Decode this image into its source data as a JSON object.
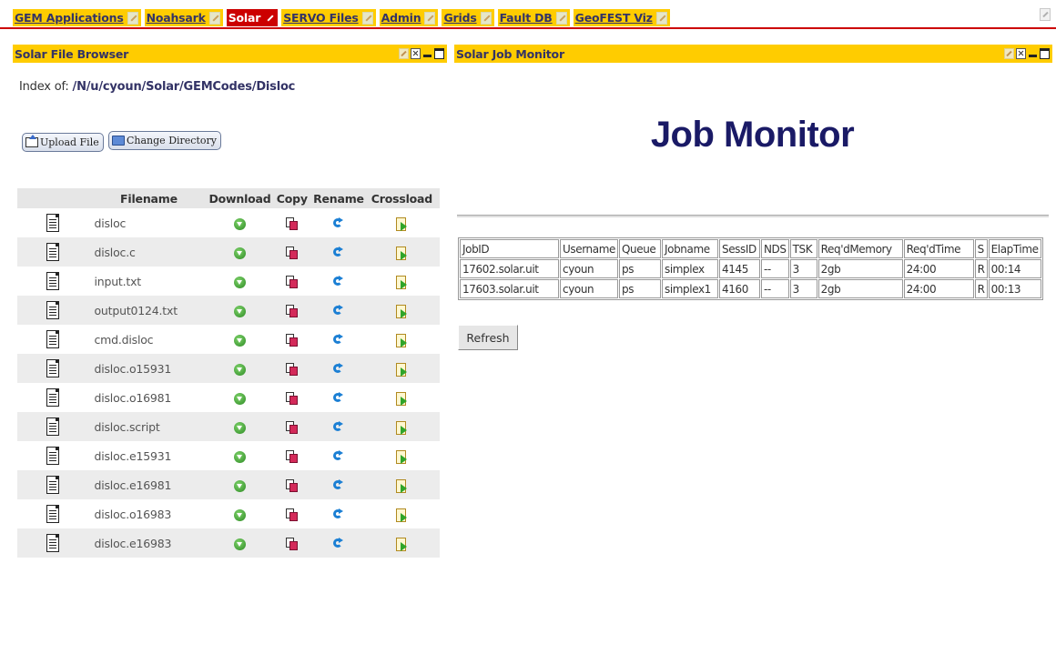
{
  "nav": {
    "tabs": [
      {
        "label": "GEM Applications",
        "active": false
      },
      {
        "label": "Noahsark",
        "active": false
      },
      {
        "label": "Solar",
        "active": true
      },
      {
        "label": "SERVO Files",
        "active": false
      },
      {
        "label": "Admin",
        "active": false
      },
      {
        "label": "Grids",
        "active": false
      },
      {
        "label": "Fault DB",
        "active": false
      },
      {
        "label": "GeoFEST Viz",
        "active": false
      }
    ]
  },
  "colors": {
    "tab_bg": "#ffcc00",
    "tab_active_bg": "#cc0000",
    "tab_text": "#333366",
    "title_text": "#1a1a66"
  },
  "file_browser": {
    "title": "Solar File Browser",
    "index_label": "Index of:",
    "path": "/N/u/cyoun/Solar/GEMCodes/Disloc",
    "upload_button": "Upload File",
    "change_dir_button": "Change Directory",
    "columns": [
      "Filename",
      "Download",
      "Copy",
      "Rename",
      "Crossload"
    ],
    "files": [
      "disloc",
      "disloc.c",
      "input.txt",
      "output0124.txt",
      "cmd.disloc",
      "disloc.o15931",
      "disloc.o16981",
      "disloc.script",
      "disloc.e15931",
      "disloc.e16981",
      "disloc.o16983",
      "disloc.e16983"
    ],
    "icons": {
      "file": "document-icon",
      "download": "download-icon",
      "copy": "copy-icon",
      "rename": "rename-icon",
      "crossload": "crossload-icon"
    }
  },
  "job_monitor": {
    "title": "Solar Job Monitor",
    "heading": "Job Monitor",
    "columns": [
      "JobID",
      "Username",
      "Queue",
      "Jobname",
      "SessID",
      "NDS",
      "TSK",
      "Req'dMemory",
      "Req'dTime",
      "S",
      "ElapTime"
    ],
    "jobs": [
      [
        "17602.solar.uit",
        "cyoun",
        "ps",
        "simplex",
        "4145",
        "--",
        "3",
        "2gb",
        "24:00",
        "R",
        "00:14"
      ],
      [
        "17603.solar.uit",
        "cyoun",
        "ps",
        "simplex1",
        "4160",
        "--",
        "3",
        "2gb",
        "24:00",
        "R",
        "00:13"
      ]
    ],
    "refresh_button": "Refresh"
  }
}
